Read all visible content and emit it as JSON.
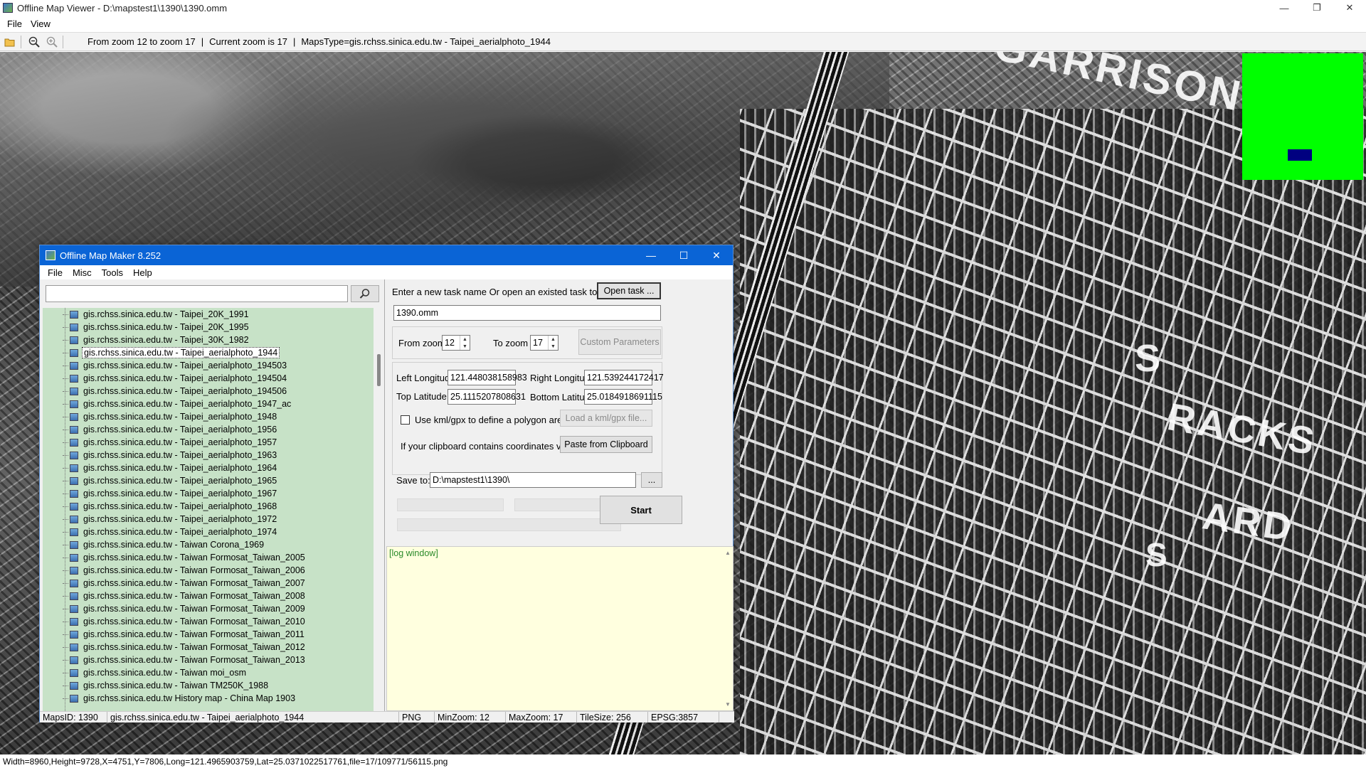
{
  "viewer": {
    "title": "Offline Map Viewer - D:\\mapstest1\\1390\\1390.omm",
    "menu": [
      "File",
      "View"
    ],
    "toolbar_info": {
      "zoom_range": "From zoom 12 to zoom 17",
      "sep1": "|",
      "current_zoom": "Current zoom is 17",
      "sep2": "|",
      "maps_type": "MapsType=gis.rchss.sinica.edu.tw - Taipei_aerialphoto_1944"
    },
    "map_labels": [
      "GARRISON",
      "S",
      "RACKS",
      "ARD",
      "S"
    ],
    "status": "Width=8960,Height=9728,X=4751,Y=7806,Long=121.4965903759,Lat=25.0371022517761,file=17/109771/56115.png",
    "colors": {
      "minimap_bg": "#00ff00",
      "minimap_view": "#000080"
    }
  },
  "dialog": {
    "title": "Offline Map Maker 8.252",
    "menu": [
      "File",
      "Misc",
      "Tools",
      "Help"
    ],
    "search_value": "",
    "tree": [
      "gis.rchss.sinica.edu.tw - Taipei_20K_1991",
      "gis.rchss.sinica.edu.tw - Taipei_20K_1995",
      "gis.rchss.sinica.edu.tw - Taipei_30K_1982",
      "gis.rchss.sinica.edu.tw - Taipei_aerialphoto_1944",
      "gis.rchss.sinica.edu.tw - Taipei_aerialphoto_194503",
      "gis.rchss.sinica.edu.tw - Taipei_aerialphoto_194504",
      "gis.rchss.sinica.edu.tw - Taipei_aerialphoto_194506",
      "gis.rchss.sinica.edu.tw - Taipei_aerialphoto_1947_ac",
      "gis.rchss.sinica.edu.tw - Taipei_aerialphoto_1948",
      "gis.rchss.sinica.edu.tw - Taipei_aerialphoto_1956",
      "gis.rchss.sinica.edu.tw - Taipei_aerialphoto_1957",
      "gis.rchss.sinica.edu.tw - Taipei_aerialphoto_1963",
      "gis.rchss.sinica.edu.tw - Taipei_aerialphoto_1964",
      "gis.rchss.sinica.edu.tw - Taipei_aerialphoto_1965",
      "gis.rchss.sinica.edu.tw - Taipei_aerialphoto_1967",
      "gis.rchss.sinica.edu.tw - Taipei_aerialphoto_1968",
      "gis.rchss.sinica.edu.tw - Taipei_aerialphoto_1972",
      "gis.rchss.sinica.edu.tw - Taipei_aerialphoto_1974",
      "gis.rchss.sinica.edu.tw - Taiwan Corona_1969",
      "gis.rchss.sinica.edu.tw - Taiwan Formosat_Taiwan_2005",
      "gis.rchss.sinica.edu.tw - Taiwan Formosat_Taiwan_2006",
      "gis.rchss.sinica.edu.tw - Taiwan Formosat_Taiwan_2007",
      "gis.rchss.sinica.edu.tw - Taiwan Formosat_Taiwan_2008",
      "gis.rchss.sinica.edu.tw - Taiwan Formosat_Taiwan_2009",
      "gis.rchss.sinica.edu.tw - Taiwan Formosat_Taiwan_2010",
      "gis.rchss.sinica.edu.tw - Taiwan Formosat_Taiwan_2011",
      "gis.rchss.sinica.edu.tw - Taiwan Formosat_Taiwan_2012",
      "gis.rchss.sinica.edu.tw - Taiwan Formosat_Taiwan_2013",
      "gis.rchss.sinica.edu.tw - Taiwan moi_osm",
      "gis.rchss.sinica.edu.tw - Taiwan TM250K_1988",
      "gis.rchss.sinica.edu.tw History map - China Map 1903"
    ],
    "selected_tree_item": "gis.rchss.sinica.edu.tw - Taipei_aerialphoto_1944",
    "prompt": "Enter a new task name Or open an existed task to continue:",
    "open_task": "Open task ...",
    "task_name": "1390.omm",
    "from_zoom_label": "From zoom",
    "from_zoom": "12",
    "to_zoom_label": "To zoom",
    "to_zoom": "17",
    "custom_params": "Custom Parameters",
    "left_lon_label": "Left Longitude",
    "left_lon": "121.448038158983",
    "right_lon_label": "Right Longitude",
    "right_lon": "121.539244172417",
    "top_lat_label": "Top Latitude",
    "top_lat": "25.1115207808631",
    "bottom_lat_label": "Bottom Latitude",
    "bottom_lat": "25.0184918691115",
    "use_kml_label": "Use kml/gpx to define a polygon area",
    "load_kml": "Load a kml/gpx file...",
    "clipboard_label": "If your clipboard contains coordinates values:",
    "paste_clipboard": "Paste from Clipboard",
    "save_to_label": "Save to:",
    "save_to": "D:\\mapstest1\\1390\\",
    "browse": "...",
    "start": "Start",
    "log": "[log window]",
    "status": {
      "maps_id": "MapsID: 1390",
      "map_name": "gis.rchss.sinica.edu.tw - Taipei_aerialphoto_1944",
      "format": "PNG",
      "min_zoom": "MinZoom: 12",
      "max_zoom": "MaxZoom: 17",
      "tile_size": "TileSize: 256",
      "epsg": "EPSG:3857"
    }
  }
}
